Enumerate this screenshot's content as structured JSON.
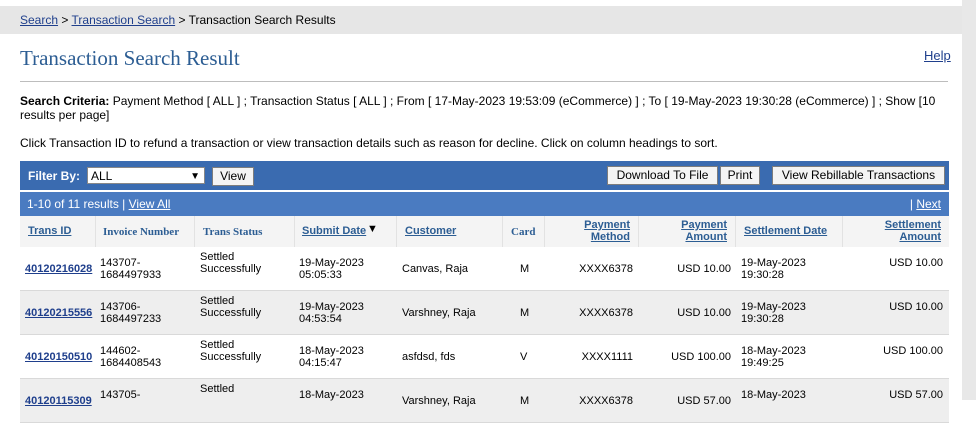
{
  "breadcrumb": {
    "search": "Search",
    "sep1": ">",
    "transaction_search": "Transaction Search",
    "sep2": ">",
    "current": "Transaction Search Results"
  },
  "page": {
    "title": "Transaction Search Result",
    "help": "Help"
  },
  "criteria": {
    "label": "Search Criteria:",
    "text": "Payment Method [ ALL ] ; Transaction Status [ ALL ] ; From [ 17-May-2023 19:53:09 (eCommerce) ] ; To [ 19-May-2023 19:30:28 (eCommerce) ] ; Show [10 results per page]"
  },
  "instructions": "Click Transaction ID to refund a transaction or view transaction details such as reason for decline. Click on column headings to sort.",
  "filter": {
    "label": "Filter By:",
    "value": "ALL",
    "view_button": "View",
    "download_button": "Download To File",
    "print_button": "Print",
    "rebillable_button": "View Rebillable Transactions"
  },
  "pagination": {
    "summary": "1-10 of 11 results |",
    "view_all": "View All",
    "sep": "|",
    "next": "Next"
  },
  "columns": {
    "trans_id": "Trans ID",
    "invoice": "Invoice Number",
    "status": "Trans Status",
    "submit_date": "Submit Date",
    "customer": "Customer",
    "card": "Card",
    "pay_method_1": "Payment",
    "pay_method_2": "Method",
    "pay_amount_1": "Payment",
    "pay_amount_2": "Amount",
    "settle_date": "Settlement Date",
    "settle_amount_1": "Settlement",
    "settle_amount_2": "Amount"
  },
  "rows": [
    {
      "id": "40120216028",
      "inv1": "143707-",
      "inv2": "1684497933",
      "st1": "Settled",
      "st2": "Successfully",
      "sd1": "19-May-2023",
      "sd2": "05:05:33",
      "cust": "Canvas, Raja",
      "card": "M",
      "method": "XXXX6378",
      "amount": "USD 10.00",
      "stl1": "19-May-2023",
      "stl2": "19:30:28",
      "stamt": "USD 10.00"
    },
    {
      "id": "40120215556",
      "inv1": "143706-",
      "inv2": "1684497233",
      "st1": "Settled",
      "st2": "Successfully",
      "sd1": "19-May-2023",
      "sd2": "04:53:54",
      "cust": "Varshney, Raja",
      "card": "M",
      "method": "XXXX6378",
      "amount": "USD 10.00",
      "stl1": "19-May-2023",
      "stl2": "19:30:28",
      "stamt": "USD 10.00"
    },
    {
      "id": "40120150510",
      "inv1": "144602-",
      "inv2": "1684408543",
      "st1": "Settled",
      "st2": "Successfully",
      "sd1": "18-May-2023",
      "sd2": "04:15:47",
      "cust": "asfdsd, fds",
      "card": "V",
      "method": "XXXX1111",
      "amount": "USD 100.00",
      "stl1": "18-May-2023",
      "stl2": "19:49:25",
      "stamt": "USD 100.00"
    },
    {
      "id": "40120115309",
      "inv1": "143705-",
      "inv2": "",
      "st1": "Settled",
      "st2": "",
      "sd1": "18-May-2023",
      "sd2": "",
      "cust": "Varshney, Raja",
      "card": "M",
      "method": "XXXX6378",
      "amount": "USD 57.00",
      "stl1": "18-May-2023",
      "stl2": "",
      "stamt": "USD 57.00"
    }
  ]
}
